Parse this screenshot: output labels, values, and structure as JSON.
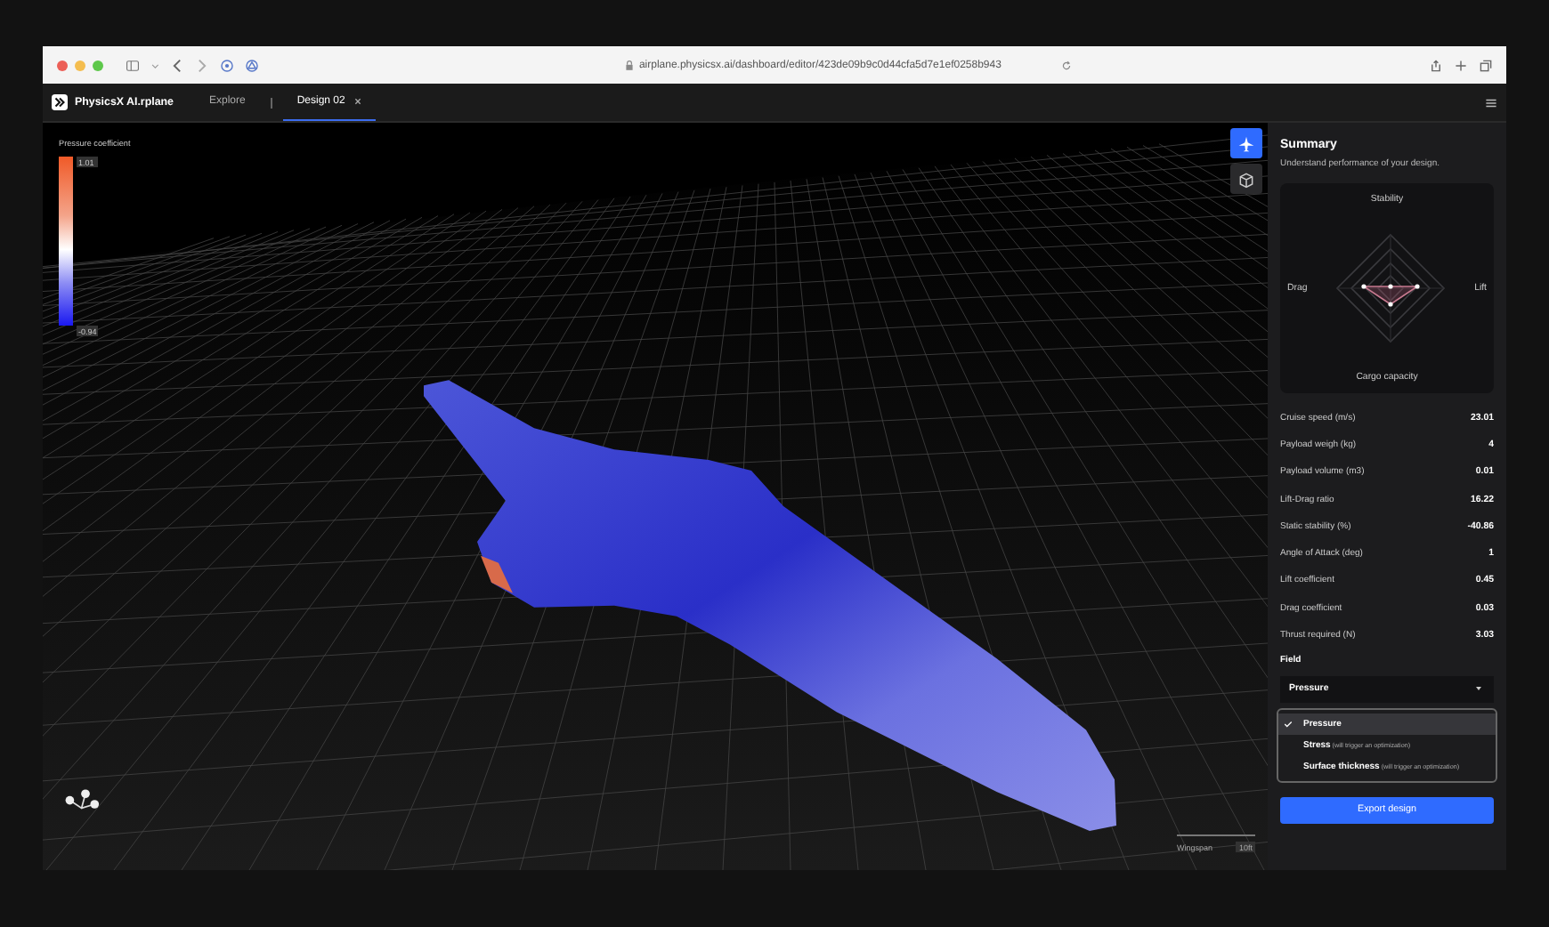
{
  "browser": {
    "url": "airplane.physicsx.ai/dashboard/editor/423de09b9c0d44cfa5d7e1ef0258b943"
  },
  "app": {
    "logo_text": "PhysicsX AI.rplane",
    "tabs": [
      {
        "label": "Explore",
        "selected": false,
        "closable": false
      },
      {
        "label": "Design 02",
        "selected": true,
        "closable": true
      }
    ]
  },
  "legend": {
    "title": "Pressure coefficient",
    "max": "1.01",
    "min": "-0.94"
  },
  "view_tools": [
    {
      "kind": "airplane",
      "selected": true
    },
    {
      "kind": "cube",
      "selected": false
    }
  ],
  "scale": {
    "label": "Wingspan",
    "value": "10ft"
  },
  "summary": {
    "title": "Summary",
    "subtitle": "Understand performance of your design.",
    "radar": {
      "top": "Stability",
      "right": "Lift",
      "bottom": "Cargo capacity",
      "left": "Drag"
    },
    "metrics": [
      {
        "label": "Cruise speed (m/s)",
        "value": "23.01"
      },
      {
        "label": "Payload weigh (kg)",
        "value": "4"
      },
      {
        "label": "Payload volume (m3)",
        "value": "0.01"
      },
      {
        "label": "Lift-Drag ratio",
        "value": "16.22"
      },
      {
        "label": "Static stability (%)",
        "value": "-40.86"
      },
      {
        "label": "Angle of Attack (deg)",
        "value": "1"
      },
      {
        "label": "Lift coefficient",
        "value": "0.45"
      },
      {
        "label": "Drag coefficient",
        "value": "0.03"
      },
      {
        "label": "Thrust required (N)",
        "value": "3.03"
      }
    ],
    "field": {
      "label": "Field",
      "value": "Pressure",
      "options": [
        {
          "label": "Pressure",
          "selected": true
        },
        {
          "label": "Stress",
          "note": "(will trigger an optimization)",
          "selected": false
        },
        {
          "label": "Surface thickness",
          "note": "(will trigger an optimization)",
          "selected": false
        }
      ]
    },
    "export_button": "Export design"
  }
}
